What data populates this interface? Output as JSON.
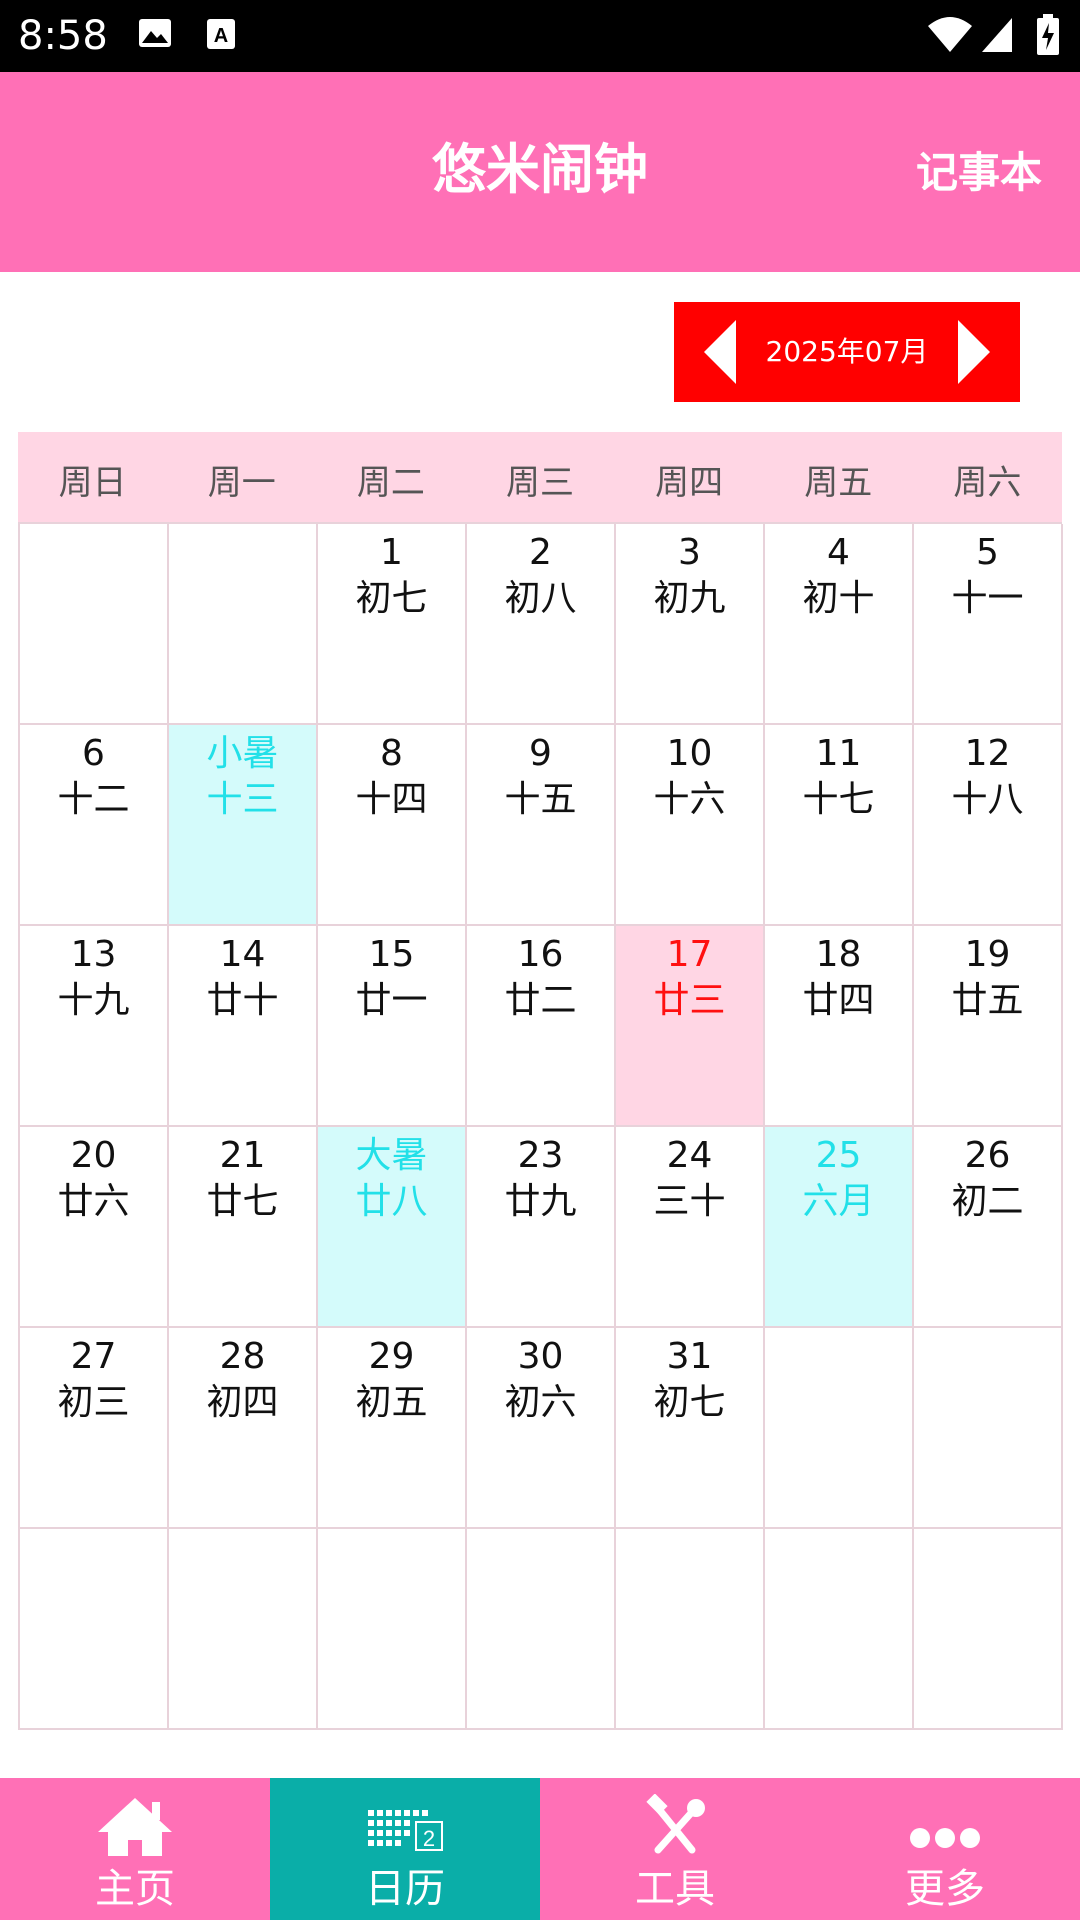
{
  "status_bar": {
    "time": "8:58"
  },
  "app_bar": {
    "title": "悠米闹钟",
    "notebook_label": "记事本"
  },
  "month_switcher": {
    "label": "2025年07月"
  },
  "calendar": {
    "weekdays": [
      "周日",
      "周一",
      "周二",
      "周三",
      "周四",
      "周五",
      "周六"
    ],
    "cells": [
      {
        "day": "",
        "lunar": "",
        "type": "empty"
      },
      {
        "day": "",
        "lunar": "",
        "type": "empty"
      },
      {
        "day": "1",
        "lunar": "初七",
        "type": "normal"
      },
      {
        "day": "2",
        "lunar": "初八",
        "type": "normal"
      },
      {
        "day": "3",
        "lunar": "初九",
        "type": "normal"
      },
      {
        "day": "4",
        "lunar": "初十",
        "type": "normal"
      },
      {
        "day": "5",
        "lunar": "十一",
        "type": "normal"
      },
      {
        "day": "6",
        "lunar": "十二",
        "type": "normal"
      },
      {
        "day": "小暑",
        "lunar": "十三",
        "type": "term"
      },
      {
        "day": "8",
        "lunar": "十四",
        "type": "normal"
      },
      {
        "day": "9",
        "lunar": "十五",
        "type": "normal"
      },
      {
        "day": "10",
        "lunar": "十六",
        "type": "normal"
      },
      {
        "day": "11",
        "lunar": "十七",
        "type": "normal"
      },
      {
        "day": "12",
        "lunar": "十八",
        "type": "normal"
      },
      {
        "day": "13",
        "lunar": "十九",
        "type": "normal"
      },
      {
        "day": "14",
        "lunar": "廿十",
        "type": "normal"
      },
      {
        "day": "15",
        "lunar": "廿一",
        "type": "normal"
      },
      {
        "day": "16",
        "lunar": "廿二",
        "type": "normal"
      },
      {
        "day": "17",
        "lunar": "廿三",
        "type": "today"
      },
      {
        "day": "18",
        "lunar": "廿四",
        "type": "normal"
      },
      {
        "day": "19",
        "lunar": "廿五",
        "type": "normal"
      },
      {
        "day": "20",
        "lunar": "廿六",
        "type": "normal"
      },
      {
        "day": "21",
        "lunar": "廿七",
        "type": "normal"
      },
      {
        "day": "大暑",
        "lunar": "廿八",
        "type": "term"
      },
      {
        "day": "23",
        "lunar": "廿九",
        "type": "normal"
      },
      {
        "day": "24",
        "lunar": "三十",
        "type": "normal"
      },
      {
        "day": "25",
        "lunar": "六月",
        "type": "term"
      },
      {
        "day": "26",
        "lunar": "初二",
        "type": "normal"
      },
      {
        "day": "27",
        "lunar": "初三",
        "type": "normal"
      },
      {
        "day": "28",
        "lunar": "初四",
        "type": "normal"
      },
      {
        "day": "29",
        "lunar": "初五",
        "type": "normal"
      },
      {
        "day": "30",
        "lunar": "初六",
        "type": "normal"
      },
      {
        "day": "31",
        "lunar": "初七",
        "type": "normal"
      },
      {
        "day": "",
        "lunar": "",
        "type": "empty"
      },
      {
        "day": "",
        "lunar": "",
        "type": "empty"
      },
      {
        "day": "",
        "lunar": "",
        "type": "empty"
      },
      {
        "day": "",
        "lunar": "",
        "type": "empty"
      },
      {
        "day": "",
        "lunar": "",
        "type": "empty"
      },
      {
        "day": "",
        "lunar": "",
        "type": "empty"
      },
      {
        "day": "",
        "lunar": "",
        "type": "empty"
      },
      {
        "day": "",
        "lunar": "",
        "type": "empty"
      },
      {
        "day": "",
        "lunar": "",
        "type": "empty"
      }
    ]
  },
  "bottom_nav": {
    "items": [
      {
        "label": "主页",
        "icon": "home-icon"
      },
      {
        "label": "日历",
        "icon": "calendar-icon"
      },
      {
        "label": "工具",
        "icon": "tools-icon"
      },
      {
        "label": "更多",
        "icon": "more-icon"
      }
    ]
  },
  "colors": {
    "primary": "#ff70b6",
    "active_tab": "#0aaea8",
    "month_switch": "#ff0000",
    "solar_term": "#22e0e8",
    "today": "#ff1010"
  }
}
